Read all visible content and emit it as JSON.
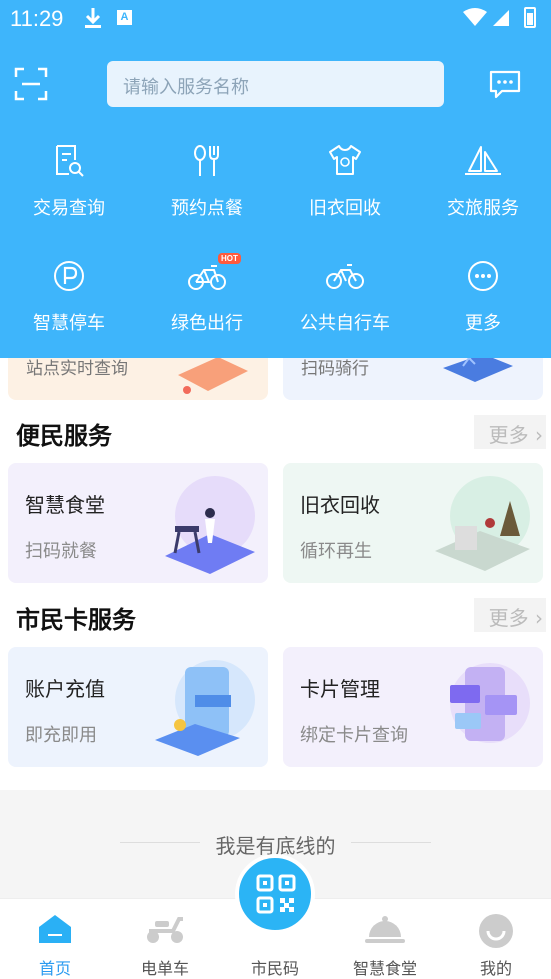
{
  "status": {
    "time": "11:29",
    "a_badge": "A"
  },
  "search": {
    "placeholder": "请输入服务名称"
  },
  "services": [
    {
      "label": "交易查询",
      "icon": "receipt-search-icon"
    },
    {
      "label": "预约点餐",
      "icon": "fork-spoon-icon"
    },
    {
      "label": "旧衣回收",
      "icon": "tshirt-recycle-icon"
    },
    {
      "label": "交旅服务",
      "icon": "sail-travel-icon"
    },
    {
      "label": "智慧停车",
      "icon": "parking-icon"
    },
    {
      "label": "绿色出行",
      "icon": "ebike-icon",
      "badge": "HOT"
    },
    {
      "label": "公共自行车",
      "icon": "bicycle-icon"
    },
    {
      "label": "更多",
      "icon": "more-dots-icon"
    }
  ],
  "peek_cards": [
    {
      "label": "站点实时查询"
    },
    {
      "label": "扫码骑行"
    }
  ],
  "convenience": {
    "title": "便民服务",
    "more": "更多",
    "cards": [
      {
        "title": "智慧食堂",
        "subtitle": "扫码就餐"
      },
      {
        "title": "旧衣回收",
        "subtitle": "循环再生"
      }
    ]
  },
  "citizen_card": {
    "title": "市民卡服务",
    "more": "更多",
    "cards": [
      {
        "title": "账户充值",
        "subtitle": "即充即用"
      },
      {
        "title": "卡片管理",
        "subtitle": "绑定卡片查询"
      }
    ]
  },
  "footer_note": "我是有底线的",
  "tabs": [
    {
      "label": "首页",
      "active": true
    },
    {
      "label": "电单车"
    },
    {
      "label": "市民码"
    },
    {
      "label": "智慧食堂"
    },
    {
      "label": "我的"
    }
  ],
  "colors": {
    "primary": "#3eb5fb",
    "active_tab": "#2a9bf0"
  }
}
